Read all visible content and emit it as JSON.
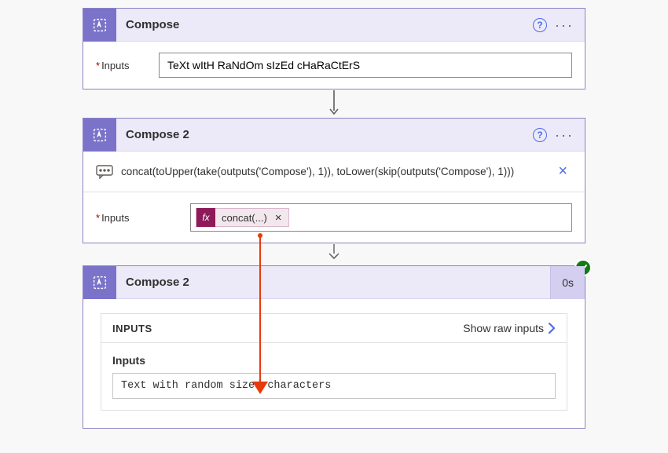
{
  "arrow_color": "#e8390b",
  "compose1": {
    "title": "Compose",
    "inputs_label": "Inputs",
    "value": "TeXt wItH RaNdOm sIzEd cHaRaCtErS"
  },
  "compose2": {
    "title": "Compose 2",
    "expression": "concat(toUpper(take(outputs('Compose'), 1)), toLower(skip(outputs('Compose'), 1)))",
    "inputs_label": "Inputs",
    "token_fx": "fx",
    "token_label": "concat(...)"
  },
  "result": {
    "title": "Compose 2",
    "duration": "0s",
    "panel_title": "INPUTS",
    "show_raw": "Show raw inputs",
    "sub_label": "Inputs",
    "output": "Text with random sized characters"
  },
  "icons": {
    "compose": "compose-icon",
    "help": "?",
    "more": "···",
    "close_x": "×",
    "token_x": "×"
  }
}
